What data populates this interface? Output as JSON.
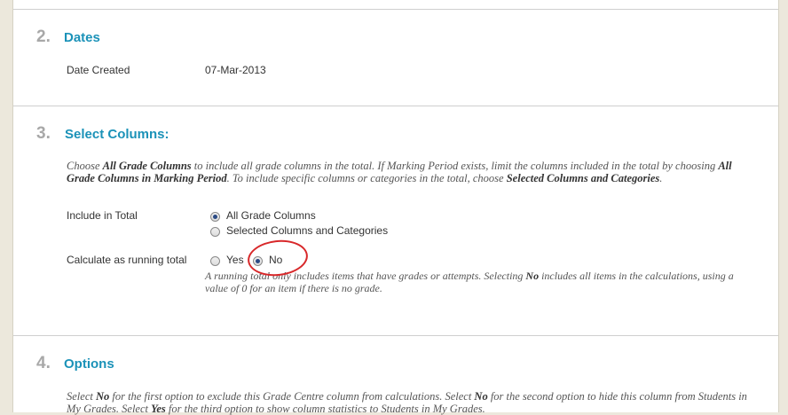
{
  "sections": {
    "dates": {
      "step": "2.",
      "title": "Dates",
      "date_created_label": "Date Created",
      "date_created_value": "07-Mar-2013"
    },
    "select_columns": {
      "step": "3.",
      "title": "Select Columns:",
      "instructions": {
        "p1": "Choose ",
        "b1": "All Grade Columns",
        "p2": " to include all grade columns in the total. If Marking Period exists, limit the columns included in the total by choosing ",
        "b2": "All Grade Columns in Marking Period",
        "p3": ". To include specific columns or categories in the total, choose ",
        "b3": "Selected Columns and Categories",
        "p4": "."
      },
      "include_label": "Include in Total",
      "include_options": [
        "All Grade Columns",
        "Selected Columns and Categories"
      ],
      "include_selected": "All Grade Columns",
      "running_label": "Calculate as running total",
      "running_options": [
        "Yes",
        "No"
      ],
      "running_selected": "No",
      "running_help": {
        "p1": "A running total only includes items that have grades or attempts. Selecting ",
        "b1": "No",
        "p2": " includes all items in the calculations, using a value of 0 for an item if there is no grade."
      }
    },
    "options": {
      "step": "4.",
      "title": "Options",
      "instructions": {
        "p1": "Select ",
        "b1": "No",
        "p2": " for the first option to exclude this Grade Centre column from calculations. Select ",
        "b2": "No",
        "p3": " for the second option to hide this column from Students in My Grades. Select ",
        "b3": "Yes",
        "p4": " for the third option to show column statistics to Students in My Grades."
      }
    }
  },
  "annotation": {
    "color": "#d8282a"
  },
  "colors": {
    "accent": "#1b92b8",
    "step": "#a8a8a8"
  }
}
